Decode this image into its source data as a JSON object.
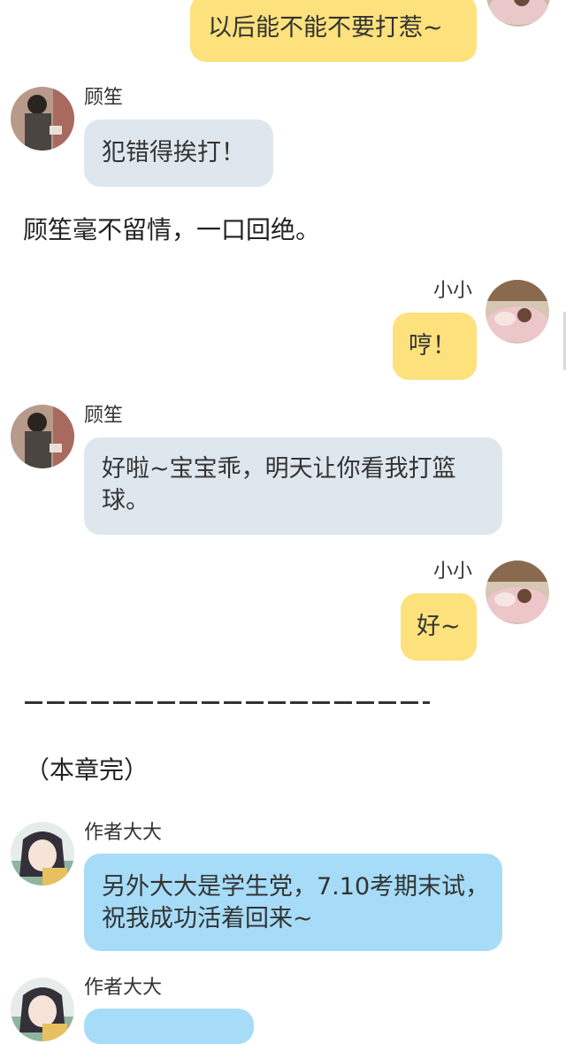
{
  "messages": {
    "m1": {
      "text": "以后能不能不要打惹~"
    },
    "m2": {
      "name": "顾笙",
      "text": "犯错得挨打！"
    },
    "m3": {
      "name": "小小",
      "text": "哼！"
    },
    "m4": {
      "name": "顾笙",
      "text": "好啦~宝宝乖，明天让你看我打篮球。"
    },
    "m5": {
      "name": "小小",
      "text": "好~"
    },
    "m6": {
      "name": "作者大大",
      "text": "另外大大是学生党，7.10考期末试，祝我成功活着回来~"
    },
    "m7": {
      "name": "作者大大"
    }
  },
  "narration": {
    "line1": "顾笙毫不留情，一口回绝。",
    "chapter_end": "（本章完）"
  },
  "colors": {
    "self_bubble": "#fde17c",
    "other_bubble": "#dfe7ee",
    "author_bubble": "#a6dcf8"
  },
  "icons": {
    "gusheng_avatar": "boy-avatar-icon",
    "xiaoxiao_avatar": "girl-sleeping-avatar-icon",
    "author_avatar": "anime-girl-avatar-icon"
  }
}
